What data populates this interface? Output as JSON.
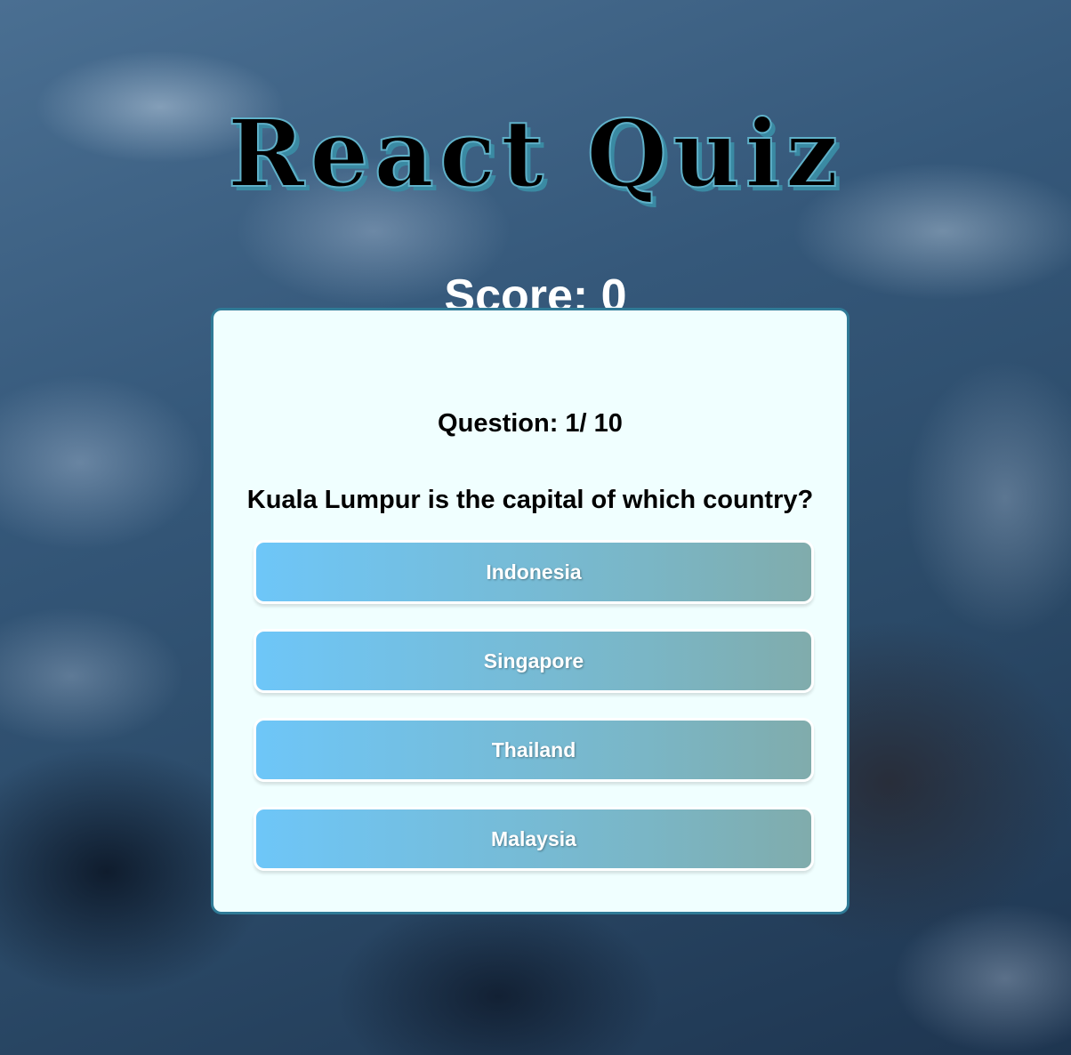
{
  "app": {
    "title": "React Quiz"
  },
  "score": {
    "label": "Score: 0"
  },
  "quiz": {
    "question_number": "Question: 1/ 10",
    "question_text": "Kuala Lumpur is the capital of which country?",
    "answers": [
      {
        "label": "Indonesia"
      },
      {
        "label": "Singapore"
      },
      {
        "label": "Thailand"
      },
      {
        "label": "Malaysia"
      }
    ]
  },
  "colors": {
    "card_background": "#f0ffff",
    "card_border": "#2f7a96",
    "button_gradient_start": "#6ec6f8",
    "button_gradient_end": "#80acac",
    "title_outline": "#5fb0c8"
  }
}
